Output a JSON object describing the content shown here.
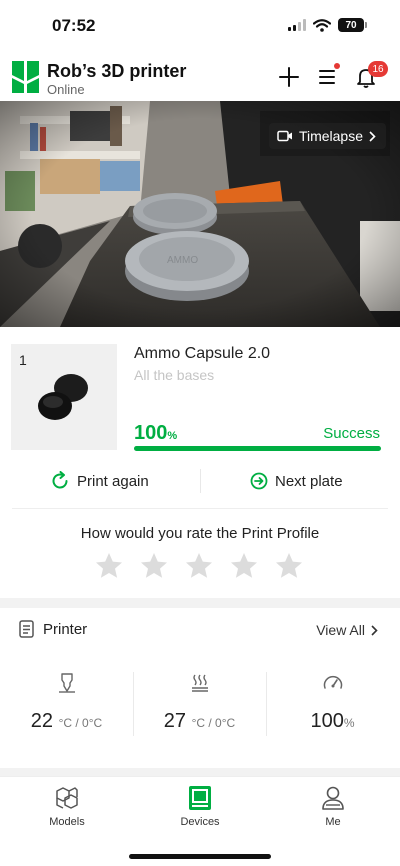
{
  "status_bar": {
    "time": "07:52",
    "battery": "70"
  },
  "header": {
    "printer_name": "Rob’s 3D printer",
    "printer_status": "Online",
    "notification_count": "16"
  },
  "camera": {
    "timelapse_label": "Timelapse"
  },
  "job": {
    "plate_index": "1",
    "title": "Ammo Capsule 2.0",
    "plate_name": "All the bases",
    "progress_value": "100",
    "progress_unit": "%",
    "progress_fraction": 1.0,
    "status": "Success"
  },
  "actions": {
    "print_again": "Print again",
    "next_plate": "Next plate"
  },
  "rating": {
    "prompt": "How would you rate the Print Profile",
    "max_stars": 5,
    "value": 0
  },
  "printer": {
    "section_title": "Printer",
    "view_all": "View All",
    "nozzle_temp": "22",
    "nozzle_unit": "°C / 0°C",
    "bed_temp": "27",
    "bed_unit": "°C / 0°C",
    "speed": "100",
    "speed_unit": "%"
  },
  "tabs": {
    "models": "Models",
    "devices": "Devices",
    "me": "Me"
  },
  "colors": {
    "accent": "#00ae42",
    "badge": "#e53935"
  }
}
